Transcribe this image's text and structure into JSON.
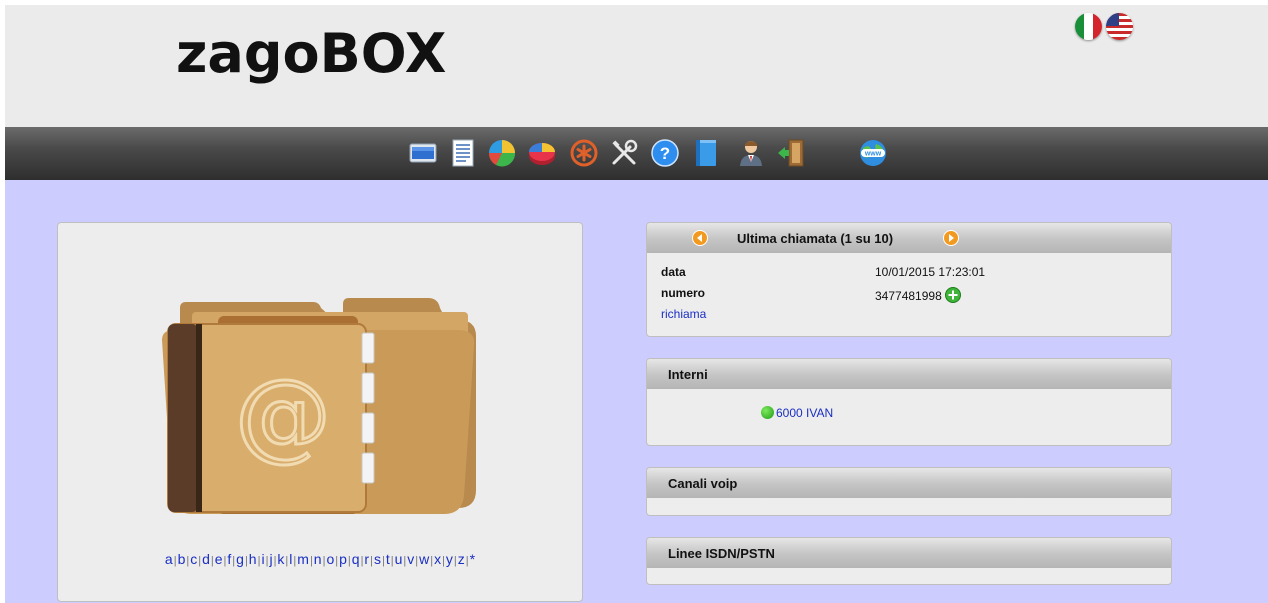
{
  "header": {
    "logo": "zagoBOX",
    "languages": [
      {
        "name": "italian",
        "icon": "italy-flag-icon"
      },
      {
        "name": "english",
        "icon": "usa-flag-icon"
      }
    ]
  },
  "toolbar": {
    "icons": [
      "monitor-icon",
      "document-list-icon",
      "pie-chart-icon",
      "pie-chart-3d-icon",
      "asterisk-icon",
      "tools-icon",
      "help-icon",
      "notebook-icon",
      "user-icon",
      "logout-door-icon",
      "www-globe-icon"
    ]
  },
  "addressbook": {
    "icon": "address-book-folder-icon",
    "letters": [
      "a",
      "b",
      "c",
      "d",
      "e",
      "f",
      "g",
      "h",
      "i",
      "j",
      "k",
      "l",
      "m",
      "n",
      "o",
      "p",
      "q",
      "r",
      "s",
      "t",
      "u",
      "v",
      "w",
      "x",
      "y",
      "z",
      "*"
    ]
  },
  "last_call": {
    "title": "Ultima chiamata (1 su 10)",
    "date_label": "data",
    "date_value": "10/01/2015 17:23:01",
    "number_label": "numero",
    "number_value": "3477481998",
    "recall_label": "richiama"
  },
  "interni": {
    "title": "Interni",
    "items": [
      {
        "label": "6000 IVAN",
        "status": "online"
      }
    ]
  },
  "voip": {
    "title": "Canali voip"
  },
  "isdn": {
    "title": "Linee ISDN/PSTN"
  },
  "colors": {
    "accent_link": "#1a2fc4",
    "main_bg": "#ccccff",
    "header_bg": "#ebebeb"
  }
}
